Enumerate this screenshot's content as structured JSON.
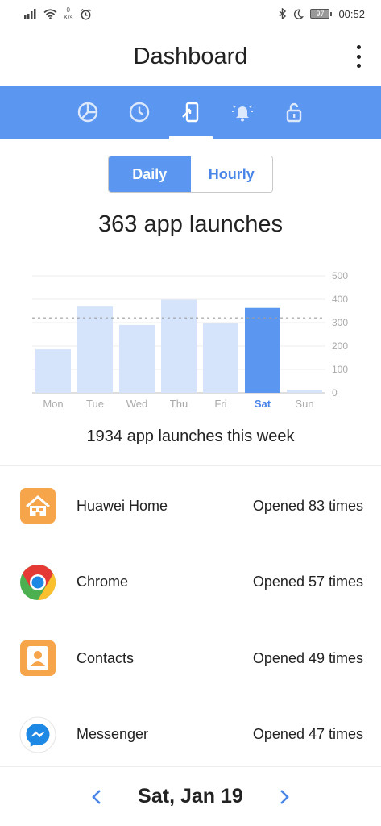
{
  "status_bar": {
    "net_speed_value": "0",
    "net_speed_unit": "K/s",
    "battery": "97",
    "time": "00:52"
  },
  "app_bar": {
    "title": "Dashboard"
  },
  "tabs": [
    {
      "icon": "pie-chart-icon",
      "active": false
    },
    {
      "icon": "clock-icon",
      "active": false
    },
    {
      "icon": "phone-tap-icon",
      "active": true
    },
    {
      "icon": "bell-ring-icon",
      "active": false
    },
    {
      "icon": "unlock-icon",
      "active": false
    }
  ],
  "toggle": {
    "daily_label": "Daily",
    "hourly_label": "Hourly",
    "selected": "Daily"
  },
  "summary": {
    "headline": "363 app launches",
    "week_total": "1934 app launches this week"
  },
  "chart_data": {
    "type": "bar",
    "categories": [
      "Mon",
      "Tue",
      "Wed",
      "Thu",
      "Fri",
      "Sat",
      "Sun"
    ],
    "values": [
      186,
      372,
      290,
      398,
      298,
      363,
      12
    ],
    "highlighted": "Sat",
    "average_line": 320,
    "ylim": [
      0,
      500
    ],
    "yticks": [
      0,
      100,
      200,
      300,
      400,
      500
    ],
    "grid": true,
    "colors": {
      "bar": "#d6e4fb",
      "highlight": "#5b96f0",
      "highlight_label": "#4a86e8"
    }
  },
  "apps": [
    {
      "name": "Huawei Home",
      "count": "Opened 83 times",
      "icon": "huawei-home-icon"
    },
    {
      "name": "Chrome",
      "count": "Opened 57 times",
      "icon": "chrome-icon"
    },
    {
      "name": "Contacts",
      "count": "Opened 49 times",
      "icon": "contacts-icon"
    },
    {
      "name": "Messenger",
      "count": "Opened 47 times",
      "icon": "messenger-icon"
    }
  ],
  "date_nav": {
    "date": "Sat, Jan 19"
  },
  "colors": {
    "accent": "#5b96f0"
  }
}
